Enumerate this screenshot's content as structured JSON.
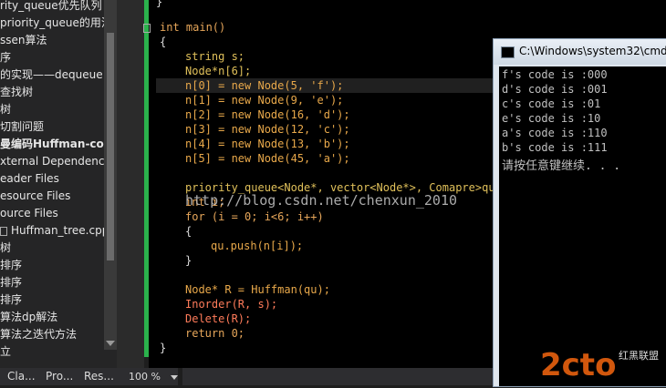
{
  "explorer": {
    "items": [
      "rity_queue优先队列",
      "priority_queue的用法",
      "ssen算法",
      "序",
      "的实现——dequeue",
      "查找树",
      "树",
      "切割问题",
      "曼编码Huffman-cod",
      "xternal Dependencie",
      "eader Files",
      "esource Files",
      "ource Files",
      "Huffman_tree.cpp",
      "树",
      "排序",
      "排序",
      "排序",
      "算法dp解法",
      "算法之迭代方法",
      "立"
    ],
    "tabs": [
      "Cla...",
      "Pro...",
      "Res..."
    ]
  },
  "code": {
    "lines": [
      "}",
      "int main()",
      "{",
      "string s;",
      "Node*n[6];",
      "n[0] = new Node(5, 'f');",
      "n[1] = new Node(9, 'e');",
      "n[2] = new Node(16, 'd');",
      "n[3] = new Node(12, 'c');",
      "n[4] = new Node(13, 'b');",
      "n[5] = new Node(45, 'a');",
      "priority_queue<Node*, vector<Node*>, Comapre>qu;",
      "int i;",
      "for (i = 0; i<6; i++)",
      "{",
      "qu.push(n[i]);",
      "}",
      "Node* R = Huffman(qu);",
      "Inorder(R, s);",
      "Delete(R);",
      "return 0;",
      "}"
    ],
    "watermark": "http://blog.csdn.net/chenxun_2010"
  },
  "console": {
    "title": "C:\\Windows\\system32\\cmd",
    "lines": [
      "f's code is :000",
      "d's code is :001",
      "c's code is :01",
      "e's code is :10",
      "a's code is :110",
      "b's code is :111",
      "请按任意键继续. . ."
    ]
  },
  "status": {
    "zoom": "100 %"
  },
  "logo": {
    "text": "2cto",
    "sub": "红黑联盟"
  },
  "colors": {
    "change_bar": "#2bb24c",
    "editor_bg": "#000000"
  }
}
